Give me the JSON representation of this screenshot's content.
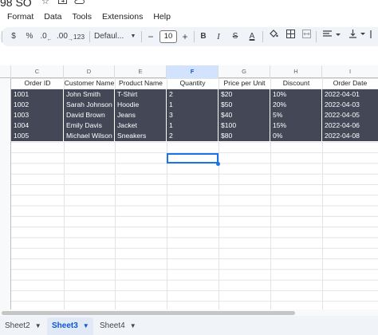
{
  "title": {
    "name": "98 SO",
    "icons": [
      "star-icon",
      "move-to-folder-icon",
      "cloud-status-icon"
    ]
  },
  "menu": [
    "Format",
    "Data",
    "Tools",
    "Extensions",
    "Help"
  ],
  "toolbar": {
    "currency": "$",
    "percent": "%",
    "decrease_decimal": ".0",
    "increase_decimal": ".00",
    "number_format": "123",
    "font_family": "Defaul...",
    "font_size_minus": "−",
    "font_size": "10",
    "font_size_plus": "+",
    "bold": "B",
    "italic": "I",
    "strikethrough": "S",
    "text_color": "A"
  },
  "columns": [
    "C",
    "D",
    "E",
    "F",
    "G",
    "H",
    "I"
  ],
  "selected_column": "F",
  "table": {
    "headers": [
      "Order ID",
      "Customer Name",
      "Product Name",
      "Quantity",
      "Price per Unit",
      "Discount",
      "Order Date"
    ],
    "rows": [
      [
        "1001",
        "John Smith",
        "T-Shirt",
        "2",
        "$20",
        "10%",
        "2022-04-01"
      ],
      [
        "1002",
        "Sarah Johnson",
        "Hoodie",
        "1",
        "$50",
        "20%",
        "2022-04-03"
      ],
      [
        "1003",
        "David Brown",
        "Jeans",
        "3",
        "$40",
        "5%",
        "2022-04-05"
      ],
      [
        "1004",
        "Emily Davis",
        "Jacket",
        "1",
        "$100",
        "15%",
        "2022-04-06"
      ],
      [
        "1005",
        "Michael Wilson",
        "Sneakers",
        "2",
        "$80",
        "0%",
        "2022-04-08"
      ]
    ]
  },
  "sheets": {
    "tabs": [
      "Sheet2",
      "Sheet3",
      "Sheet4"
    ],
    "active": "Sheet3"
  },
  "colors": {
    "data_row_bg": "#434756",
    "accent": "#1a73e8",
    "active_tab": "#0b57d0"
  }
}
